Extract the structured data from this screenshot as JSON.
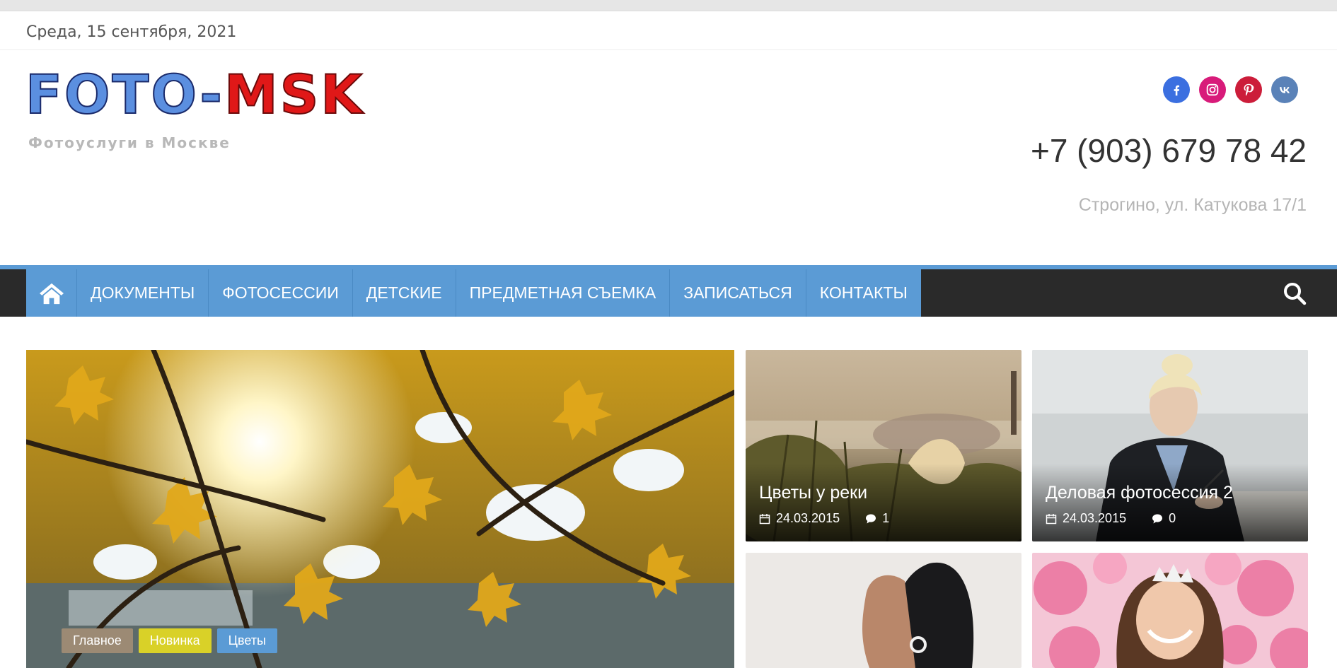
{
  "topbar": {
    "date": "Среда, 15 сентября, 2021"
  },
  "logo": {
    "part1": "FOTO-",
    "part2": "MSK",
    "tagline": "Фотоуслуги в Москве"
  },
  "socials": [
    "facebook-icon",
    "instagram-icon",
    "pinterest-icon",
    "vk-icon"
  ],
  "contact": {
    "phone": "+7 (903) 679 78 42",
    "address": "Строгино, ул. Катукова 17/1"
  },
  "nav": {
    "items": [
      {
        "label": "ДОКУМЕНТЫ"
      },
      {
        "label": "ФОТОСЕССИИ"
      },
      {
        "label": "ДЕТСКИЕ"
      },
      {
        "label": "ПРЕДМЕТНАЯ СЪЕМКА"
      },
      {
        "label": "ЗАПИСАТЬСЯ"
      },
      {
        "label": "КОНТАКТЫ"
      }
    ]
  },
  "hero": {
    "tags": [
      {
        "label": "Главное"
      },
      {
        "label": "Новинка"
      },
      {
        "label": "Цветы"
      }
    ]
  },
  "cards": [
    {
      "title": "Цветы у реки",
      "date": "24.03.2015",
      "comments": "1"
    },
    {
      "title": "Деловая фотосессия 2",
      "date": "24.03.2015",
      "comments": "0"
    }
  ],
  "colors": {
    "accent": "#5b9bd5",
    "nav_dark": "#2a2a2a",
    "tag_main": "#9c8a74",
    "tag_new": "#d9d128"
  }
}
